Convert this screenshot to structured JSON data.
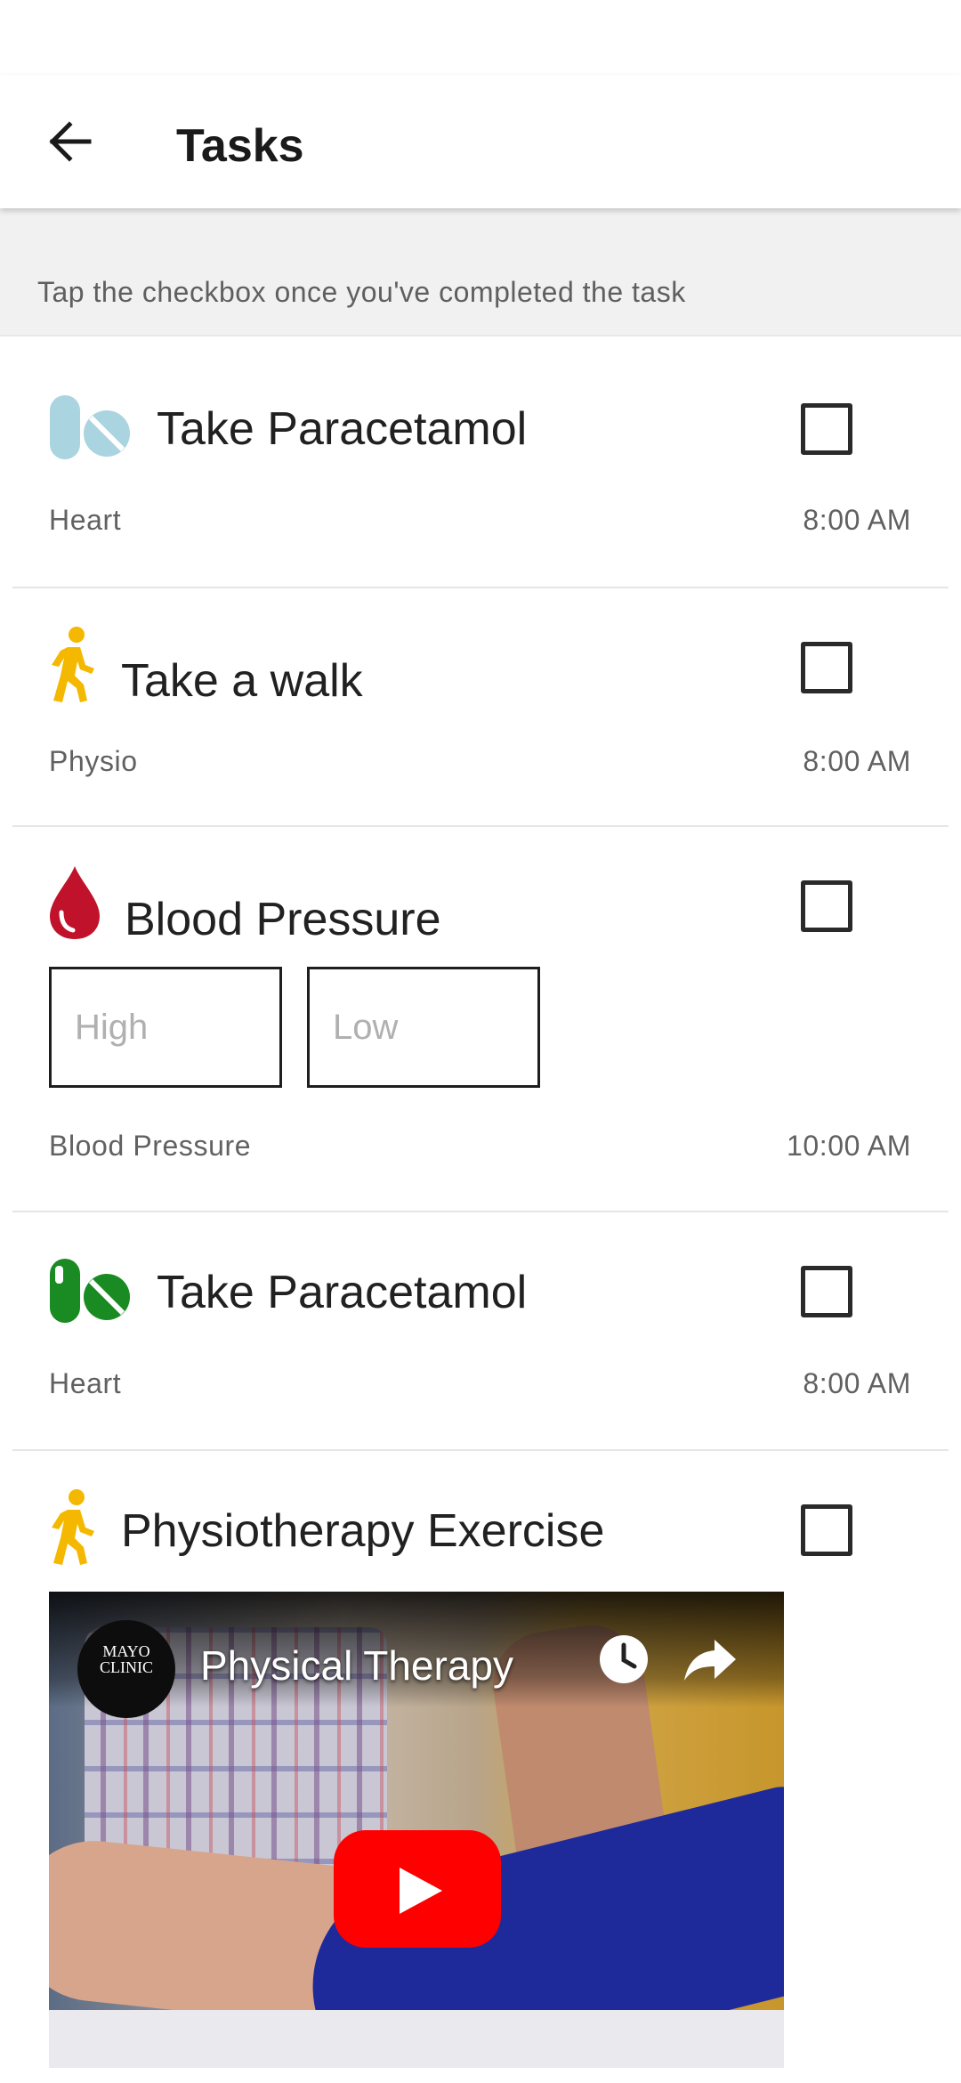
{
  "app_bar": {
    "title": "Tasks"
  },
  "hint": "Tap the checkbox once you've completed the task",
  "tasks": [
    {
      "title": "Take Paracetamol",
      "category": "Heart",
      "time": "8:00 AM",
      "icon": "pill-icon",
      "icon_color": "#a9d4e0",
      "checked": false
    },
    {
      "title": "Take a walk",
      "category": "Physio",
      "time": "8:00 AM",
      "icon": "walking-person-icon",
      "icon_color": "#f5b800",
      "checked": false
    },
    {
      "title": "Blood Pressure",
      "category": "Blood Pressure",
      "time": "10:00 AM",
      "icon": "blood-drop-icon",
      "icon_color": "#c0132b",
      "checked": false,
      "inputs": {
        "high_placeholder": "High",
        "low_placeholder": "Low"
      }
    },
    {
      "title": "Take Paracetamol",
      "category": "Heart",
      "time": "8:00 AM",
      "icon": "pill-icon",
      "icon_color": "#1a8a23",
      "checked": false
    },
    {
      "title": "Physiotherapy Exercise",
      "icon": "walking-person-icon",
      "icon_color": "#f5b800",
      "checked": false,
      "video": {
        "title": "Physical Therapy",
        "channel_logo_text": "MAYO CLINIC"
      }
    }
  ]
}
